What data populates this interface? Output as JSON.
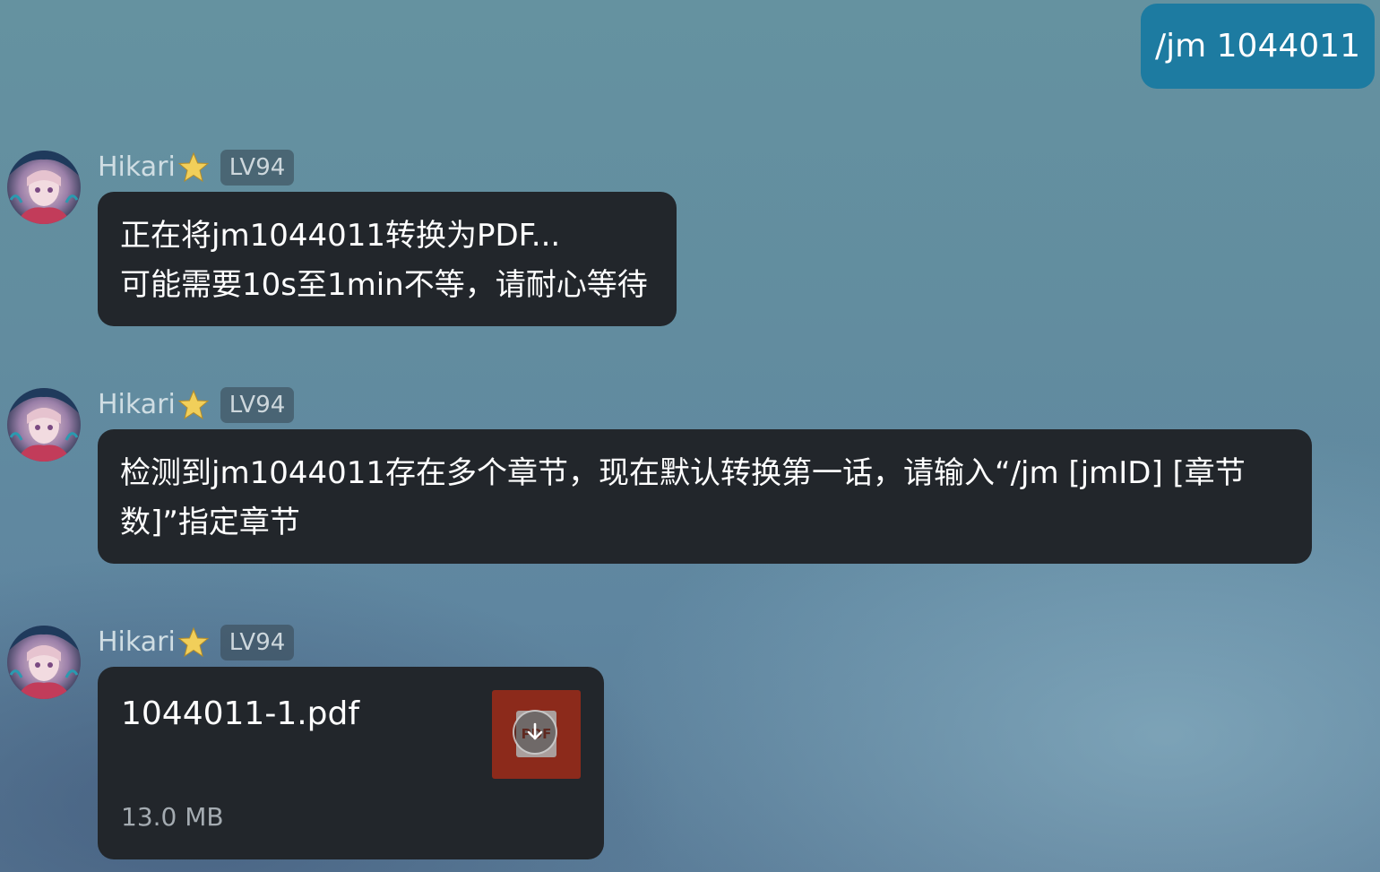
{
  "outgoing": {
    "text": "/jm 1044011"
  },
  "messages": [
    {
      "sender": "Hikari",
      "level": "LV94",
      "lines": [
        "正在将jm1044011转换为PDF...",
        "可能需要10s至1min不等，请耐心等待"
      ]
    },
    {
      "sender": "Hikari",
      "level": "LV94",
      "lines": [
        "检测到jm1044011存在多个章节，现在默认转换第一话，请输入“/jm [jmID] [章节",
        "数]”指定章节"
      ]
    }
  ],
  "file_message": {
    "sender": "Hikari",
    "level": "LV94",
    "file_name": "1044011-1.pdf",
    "file_size": "13.0 MB",
    "thumb_label": "PDF",
    "thumb_color": "#8c2a1b",
    "action_icon": "download-icon"
  },
  "colors": {
    "outgoing_bubble": "#1d7ba1",
    "incoming_bubble": "#22262b",
    "name": "#cfdde3"
  },
  "icons": {
    "sender_badge": "star-icon",
    "avatar": "avatar-image"
  }
}
